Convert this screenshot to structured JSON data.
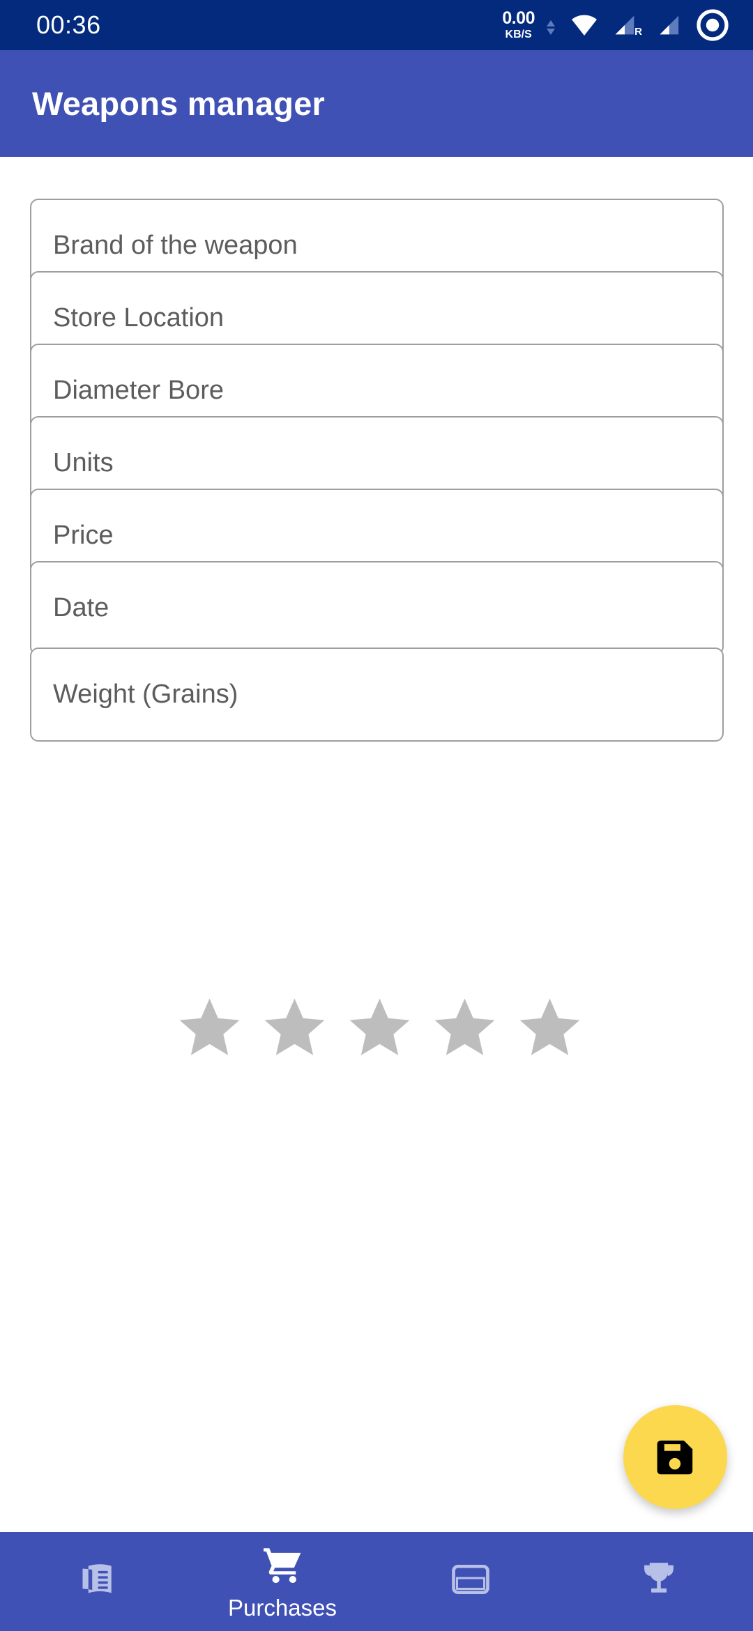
{
  "status_bar": {
    "time": "00:36",
    "network_speed_value": "0.00",
    "network_speed_unit": "KB/S",
    "icons": [
      "wifi-icon",
      "signal-roaming-icon",
      "signal-icon",
      "screen-record-icon"
    ],
    "roaming_label": "R",
    "background_color": "#042a7e"
  },
  "app_bar": {
    "title": "Weapons manager",
    "background_color": "#3f51b5"
  },
  "form": {
    "fields": [
      {
        "name": "brand",
        "placeholder": "Brand of the weapon",
        "value": ""
      },
      {
        "name": "store-location",
        "placeholder": "Store Location",
        "value": ""
      },
      {
        "name": "diameter-bore",
        "placeholder": "Diameter Bore",
        "value": ""
      },
      {
        "name": "units",
        "placeholder": "Units",
        "value": ""
      },
      {
        "name": "price",
        "placeholder": "Price",
        "value": ""
      },
      {
        "name": "date",
        "placeholder": "Date",
        "value": ""
      },
      {
        "name": "weight-grains",
        "placeholder": "Weight (Grains)",
        "value": ""
      }
    ],
    "rating": {
      "max": 5,
      "value": 0,
      "empty_color": "#bdbdbd",
      "filled_color": "#fcd84f"
    }
  },
  "fab": {
    "icon": "save-icon",
    "background_color": "#fcd84f",
    "icon_color": "#000000"
  },
  "bottom_nav": {
    "background_color": "#3f51b5",
    "active_index": 1,
    "items": [
      {
        "icon": "book-icon",
        "label": ""
      },
      {
        "icon": "shopping-cart-icon",
        "label": "Purchases"
      },
      {
        "icon": "credit-card-icon",
        "label": ""
      },
      {
        "icon": "trophy-icon",
        "label": ""
      }
    ]
  }
}
